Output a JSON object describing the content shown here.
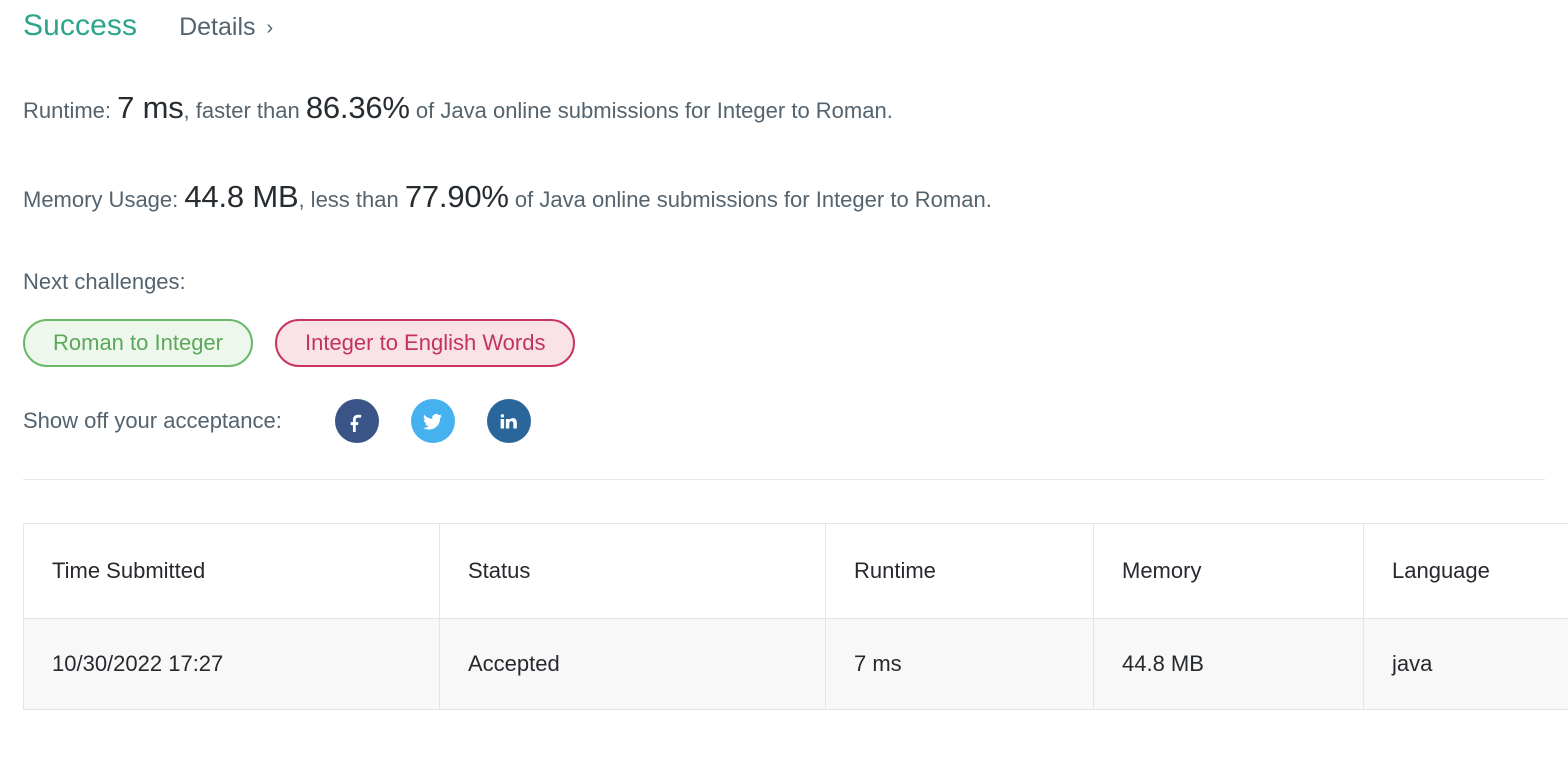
{
  "header": {
    "status_title": "Success",
    "details_label": "Details",
    "details_chevron": "›",
    "success_color": "#2da58c"
  },
  "metrics": {
    "runtime": {
      "label": "Runtime: ",
      "value": "7 ms",
      "mid_text": ", faster than ",
      "percent": "86.36%",
      "suffix": " of Java online submissions for Integer to Roman."
    },
    "memory": {
      "label": "Memory Usage: ",
      "value": "44.8 MB",
      "mid_text": ", less than ",
      "percent": "77.90%",
      "suffix": " of Java online submissions for Integer to Roman."
    }
  },
  "next_challenges": {
    "label": "Next challenges:",
    "items": [
      {
        "label": "Roman to Integer",
        "color": "#5aa85a",
        "background": "#eef7ec",
        "border": "#6cb86a"
      },
      {
        "label": "Integer to English Words",
        "color": "#c2345c",
        "background": "#fae2e9",
        "border": "#c9365f"
      }
    ]
  },
  "share": {
    "label": "Show off your acceptance:",
    "networks": [
      {
        "name": "facebook-icon",
        "color": "#3b5487"
      },
      {
        "name": "twitter-icon",
        "color": "#46b1ef"
      },
      {
        "name": "linkedin-icon",
        "color": "#2a6699"
      }
    ]
  },
  "submissions_table": {
    "columns": [
      "Time Submitted",
      "Status",
      "Runtime",
      "Memory",
      "Language"
    ],
    "rows": [
      {
        "time_submitted": "10/30/2022 17:27",
        "status": "Accepted",
        "runtime": "7 ms",
        "memory": "44.8 MB",
        "language": "java",
        "status_color": "#2b8d7c"
      }
    ]
  }
}
